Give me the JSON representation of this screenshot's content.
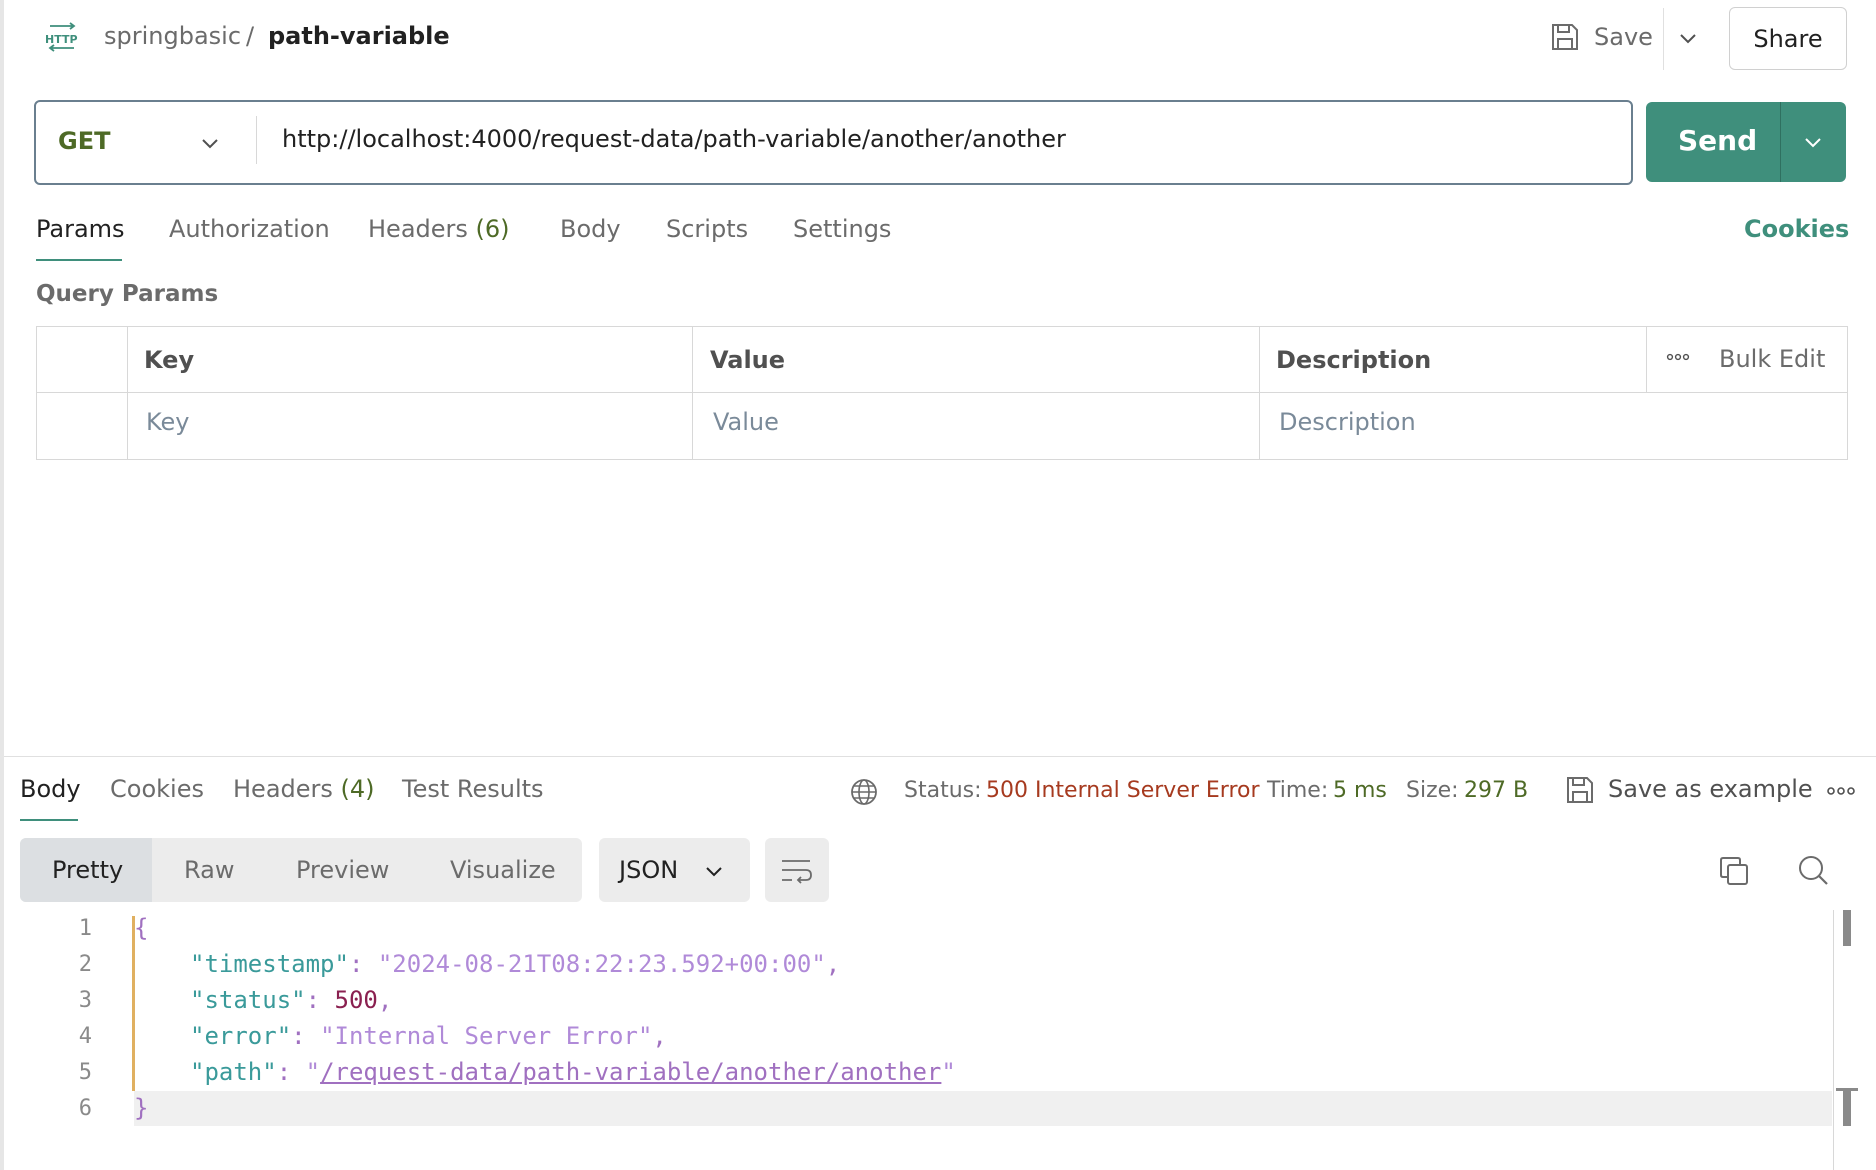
{
  "header": {
    "collection": "springbasic",
    "separator": "/",
    "request_name": "path-variable",
    "save_label": "Save",
    "share_label": "Share"
  },
  "request": {
    "method": "GET",
    "url": "http://localhost:4000/request-data/path-variable/another/another",
    "send_label": "Send"
  },
  "tabs": {
    "params": "Params",
    "authorization": "Authorization",
    "headers": "Headers",
    "headers_count": "(6)",
    "body": "Body",
    "scripts": "Scripts",
    "settings": "Settings",
    "cookies": "Cookies"
  },
  "query_params": {
    "title": "Query Params",
    "columns": {
      "key": "Key",
      "value": "Value",
      "description": "Description"
    },
    "bulk_edit": "Bulk Edit",
    "placeholder": {
      "key": "Key",
      "value": "Value",
      "description": "Description"
    }
  },
  "response": {
    "tabs": {
      "body": "Body",
      "cookies": "Cookies",
      "headers": "Headers",
      "headers_count": "(4)",
      "test_results": "Test Results"
    },
    "status_label": "Status:",
    "status_value": "500 Internal Server Error",
    "time_label": "Time:",
    "time_value": "5 ms",
    "size_label": "Size:",
    "size_value": "297 B",
    "save_example": "Save as example",
    "formats": {
      "pretty": "Pretty",
      "raw": "Raw",
      "preview": "Preview",
      "visualize": "Visualize"
    },
    "language": "JSON",
    "line_numbers": [
      "1",
      "2",
      "3",
      "4",
      "5",
      "6"
    ],
    "code": {
      "open": "{",
      "close": "}",
      "timestamp_key": "\"timestamp\"",
      "timestamp_val": "\"2024-08-21T08:22:23.592+00:00\"",
      "status_key": "\"status\"",
      "status_val": "500",
      "error_key": "\"error\"",
      "error_val": "\"Internal Server Error\"",
      "path_key": "\"path\"",
      "path_val": "/request-data/path-variable/another/another",
      "quote": "\"",
      "colon": ": ",
      "comma": ","
    }
  },
  "colors": {
    "accent": "#3f8f7c",
    "method": "#4e6a26",
    "error": "#a63a1f"
  }
}
